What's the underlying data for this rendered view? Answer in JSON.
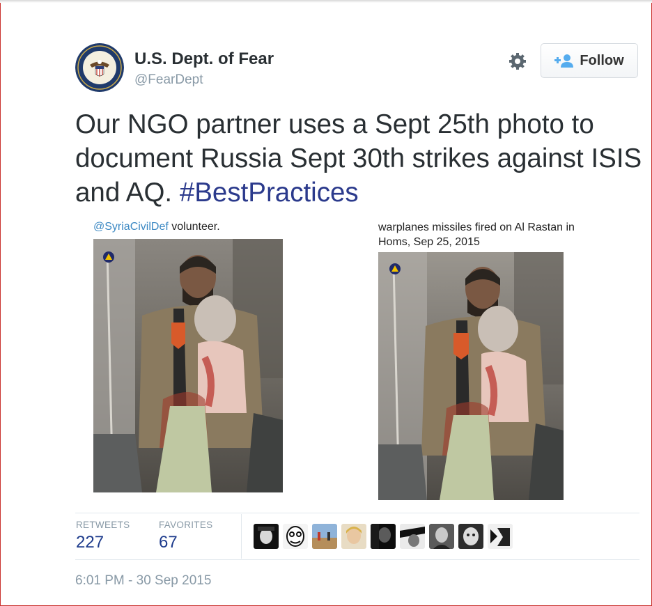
{
  "account": {
    "display_name": "U.S. Dept. of Fear",
    "handle": "@FearDept"
  },
  "actions": {
    "follow_label": "Follow"
  },
  "tweet": {
    "text_main": "Our NGO partner uses a Sept 25th photo to document Russia Sept 30th strikes against ISIS and AQ. ",
    "hashtag": "#BestPractices"
  },
  "media": {
    "left_caption_mention": "@SyriaCivilDef",
    "left_caption_rest": " volunteer.",
    "right_caption": "warplanes missiles fired on Al Rastan in Homs, Sep 25, 2015"
  },
  "stats": {
    "retweets_label": "RETWEETS",
    "retweets_value": "227",
    "favorites_label": "FAVORITES",
    "favorites_value": "67"
  },
  "favoriters": [
    {
      "icon": "user-avatar-1"
    },
    {
      "icon": "user-avatar-2"
    },
    {
      "icon": "user-avatar-3"
    },
    {
      "icon": "user-avatar-4"
    },
    {
      "icon": "user-avatar-5"
    },
    {
      "icon": "user-avatar-6"
    },
    {
      "icon": "user-avatar-7"
    },
    {
      "icon": "user-avatar-8"
    },
    {
      "icon": "user-avatar-9"
    }
  ],
  "timestamp": "6:01 PM - 30 Sep 2015",
  "colors": {
    "hashtag": "#2b3a8c",
    "mention": "#3b88c3",
    "stat_value": "#1d3b8c",
    "muted": "#8899a6",
    "frame": "#c9302c"
  }
}
